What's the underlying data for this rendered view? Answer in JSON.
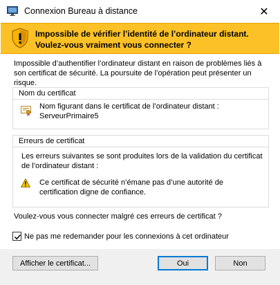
{
  "window": {
    "title": "Connexion Bureau à distance",
    "close_glyph": "✕"
  },
  "banner": {
    "line1": "Impossible de vérifier l’identité de l’ordinateur distant.",
    "line2": "Voulez-vous vraiment vous connecter ?",
    "color": "#fbc126"
  },
  "message": "Impossible d’authentifier l’ordinateur distant en raison de problèmes liés à son certificat de sécurité. La poursuite de l’opération peut présenter un risque.",
  "certificate_group": {
    "header": "Nom du certificat",
    "line1": "Nom figurant dans le certificat de l’ordinateur distant :",
    "line2": "ServeurPrimaire5",
    "icon": "certificate-icon"
  },
  "errors_group": {
    "header": "Erreurs de certificat",
    "intro": "Les erreurs suivantes se sont produites lors de la validation du certificat de l’ordinateur distant :",
    "error": "Ce certificat de sécurité n’émane pas d’une autorité de certification digne de confiance.",
    "icon": "warning-icon"
  },
  "question": "Voulez-vous vous connecter malgré ces erreurs de certificat ?",
  "dont_ask": {
    "label": "Ne pas me redemander pour les connexions à cet ordinateur",
    "checked": true
  },
  "buttons": {
    "show_certificate": "Afficher le certificat...",
    "yes": "Oui",
    "no": "Non"
  }
}
